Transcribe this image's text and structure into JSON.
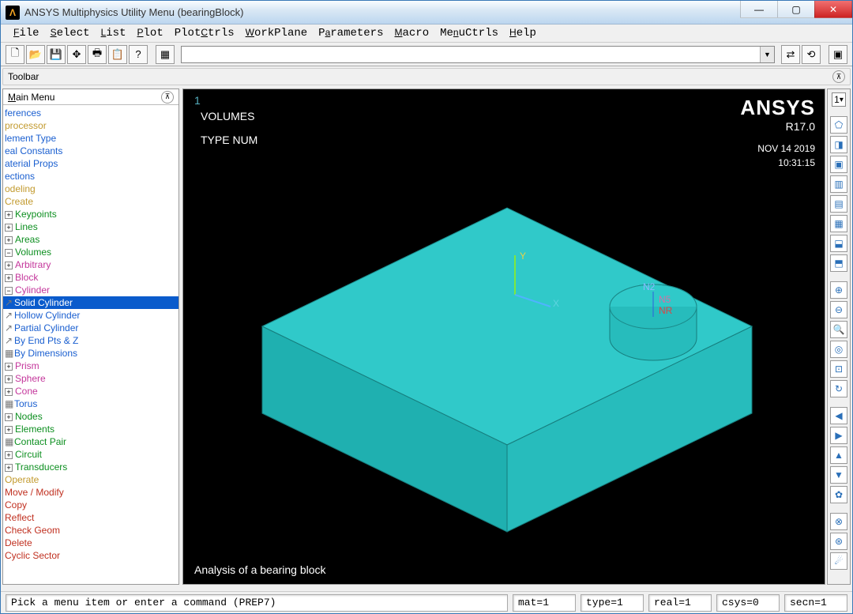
{
  "window": {
    "title": "ANSYS Multiphysics Utility Menu (bearingBlock)"
  },
  "menubar": [
    "File",
    "Select",
    "List",
    "Plot",
    "PlotCtrls",
    "WorkPlane",
    "Parameters",
    "Macro",
    "MenuCtrls",
    "Help"
  ],
  "toolbar_label": "Toolbar",
  "mainmenu": {
    "title": "Main Menu",
    "items": [
      {
        "l": "ferences",
        "c": "c-blue",
        "i": 0
      },
      {
        "l": "processor",
        "c": "c-gold",
        "i": 0
      },
      {
        "l": "lement Type",
        "c": "c-blue",
        "i": 0
      },
      {
        "l": "eal Constants",
        "c": "c-blue",
        "i": 0
      },
      {
        "l": "aterial Props",
        "c": "c-blue",
        "i": 0
      },
      {
        "l": "ections",
        "c": "c-blue",
        "i": 0
      },
      {
        "l": "odeling",
        "c": "c-gold",
        "i": 0
      },
      {
        "l": "Create",
        "c": "c-gold",
        "i": 1
      },
      {
        "l": "Keypoints",
        "c": "c-green",
        "i": 2,
        "exp": "+"
      },
      {
        "l": "Lines",
        "c": "c-green",
        "i": 2,
        "exp": "+"
      },
      {
        "l": "Areas",
        "c": "c-green",
        "i": 2,
        "exp": "+"
      },
      {
        "l": "Volumes",
        "c": "c-green",
        "i": 2,
        "exp": "−"
      },
      {
        "l": "Arbitrary",
        "c": "c-pink",
        "i": 3,
        "exp": "+"
      },
      {
        "l": "Block",
        "c": "c-pink",
        "i": 3,
        "exp": "+"
      },
      {
        "l": "Cylinder",
        "c": "c-pink",
        "i": 3,
        "exp": "−"
      },
      {
        "l": "Solid Cylinder",
        "c": "c-blue",
        "i": 4,
        "leaf": "↗",
        "sel": true
      },
      {
        "l": "Hollow Cylinder",
        "c": "c-blue",
        "i": 4,
        "leaf": "↗"
      },
      {
        "l": "Partial Cylinder",
        "c": "c-blue",
        "i": 4,
        "leaf": "↗"
      },
      {
        "l": "By End Pts & Z",
        "c": "c-blue",
        "i": 4,
        "leaf": "↗"
      },
      {
        "l": "By Dimensions",
        "c": "c-blue",
        "i": 4,
        "leaf": "▦"
      },
      {
        "l": "Prism",
        "c": "c-pink",
        "i": 3,
        "exp": "+"
      },
      {
        "l": "Sphere",
        "c": "c-pink",
        "i": 3,
        "exp": "+"
      },
      {
        "l": "Cone",
        "c": "c-pink",
        "i": 3,
        "exp": "+"
      },
      {
        "l": "Torus",
        "c": "c-blue",
        "i": 3,
        "leaf": "▦"
      },
      {
        "l": "Nodes",
        "c": "c-green",
        "i": 2,
        "exp": "+"
      },
      {
        "l": "Elements",
        "c": "c-green",
        "i": 2,
        "exp": "+"
      },
      {
        "l": "Contact Pair",
        "c": "c-green",
        "i": 2,
        "leaf": "▦"
      },
      {
        "l": "Circuit",
        "c": "c-green",
        "i": 2,
        "exp": "+"
      },
      {
        "l": "Transducers",
        "c": "c-green",
        "i": 2,
        "exp": "+"
      },
      {
        "l": "Operate",
        "c": "c-gold",
        "i": 1
      },
      {
        "l": "Move / Modify",
        "c": "c-red",
        "i": 1
      },
      {
        "l": "Copy",
        "c": "c-red",
        "i": 1
      },
      {
        "l": "Reflect",
        "c": "c-red",
        "i": 1
      },
      {
        "l": "Check Geom",
        "c": "c-red",
        "i": 1
      },
      {
        "l": "Delete",
        "c": "c-red",
        "i": 1
      },
      {
        "l": "Cyclic Sector",
        "c": "c-red",
        "i": 1
      }
    ]
  },
  "viewport": {
    "corner_num": "1",
    "label1": "VOLUMES",
    "label2": "TYPE NUM",
    "brand": "ANSYS",
    "version": "R17.0",
    "date": "NOV 14 2019",
    "time": "10:31:15",
    "footer": "Analysis of a bearing block",
    "axes": {
      "x": "X",
      "y": "Y"
    },
    "marks": {
      "m1": "N2",
      "m2": "N5",
      "m3": "NR"
    }
  },
  "status": {
    "prompt": "Pick a menu item or enter a command (PREP7)",
    "mat": "mat=1",
    "type": "type=1",
    "real": "real=1",
    "csys": "csys=0",
    "secn": "secn=1"
  },
  "side_picker": "1"
}
